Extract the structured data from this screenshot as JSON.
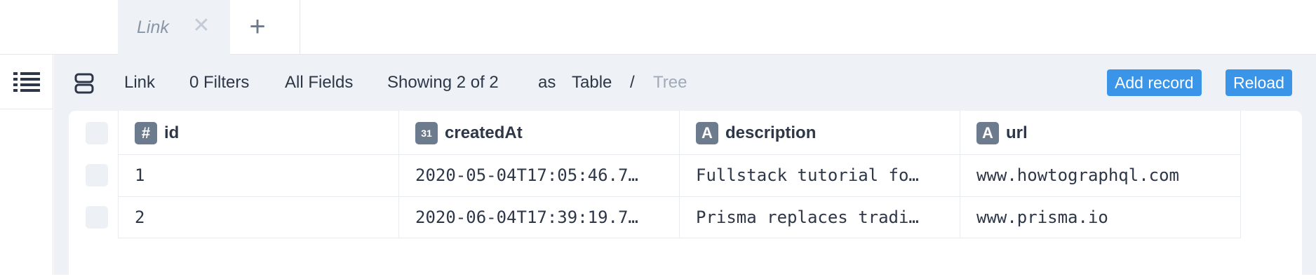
{
  "tabs": [
    {
      "label": "Link",
      "close_icon": "close-icon"
    }
  ],
  "add_tab_icon": "plus-icon",
  "sidebar": {
    "icon": "list-icon"
  },
  "toolbar": {
    "layout_icon": "layout-rows-icon",
    "model": "Link",
    "filters": "0 Filters",
    "fields": "All Fields",
    "showing": "Showing 2 of 2",
    "as": "as",
    "view_table": "Table",
    "view_sep": "/",
    "view_tree": "Tree",
    "add_record": "Add record",
    "reload": "Reload",
    "accent_color": "#3a95e8"
  },
  "table": {
    "columns": [
      {
        "icon": "#",
        "icon_name": "hash-icon",
        "label": "id"
      },
      {
        "icon": "31",
        "icon_name": "calendar-icon",
        "label": "createdAt"
      },
      {
        "icon": "A",
        "icon_name": "text-icon",
        "label": "description"
      },
      {
        "icon": "A",
        "icon_name": "text-icon",
        "label": "url"
      }
    ],
    "rows": [
      [
        "1",
        "2020-05-04T17:05:46.7…",
        "Fullstack tutorial fo…",
        "www.howtographql.com"
      ],
      [
        "2",
        "2020-06-04T17:39:19.7…",
        "Prisma replaces tradi…",
        "www.prisma.io"
      ]
    ]
  }
}
